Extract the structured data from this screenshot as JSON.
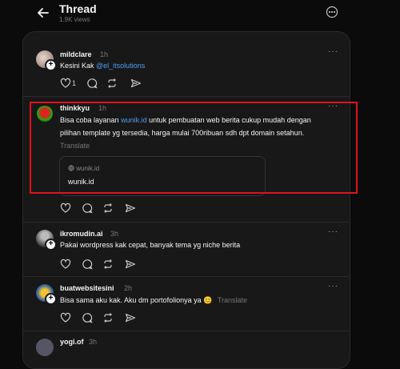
{
  "header": {
    "title": "Thread",
    "views": "1.9K views"
  },
  "posts": [
    {
      "username": "mildclare",
      "time": "1h",
      "text_before": "Kesini Kak ",
      "mention": "@el_itsolutions",
      "likes": "1"
    },
    {
      "username": "thinkkyu",
      "time": "1h",
      "text_before": "Bisa coba layanan ",
      "link": "wunik.id",
      "text_after": " untuk pembuatan web berita cukup mudah dengan pilihan template yg tersedia, harga mulai 700ribuan sdh dpt domain setahun.",
      "translate": "Translate",
      "preview": {
        "domain": "wunik.id",
        "title": "wunik.id"
      }
    },
    {
      "username": "ikromudin.ai",
      "time": "3h",
      "text": "Pakai wordpress kak cepat, banyak tema yg niche berita"
    },
    {
      "username": "buatwebsitesini",
      "time": "2h",
      "text": "Bisa sama aku kak. Aku dm portofolionya ya 😊",
      "translate": "Translate"
    },
    {
      "username": "yogi.of",
      "time": "3h"
    }
  ],
  "colors": {
    "accent_link": "#4a9ff5",
    "highlight": "#e0121a",
    "background": "#0b0b0b",
    "card": "#181818"
  }
}
